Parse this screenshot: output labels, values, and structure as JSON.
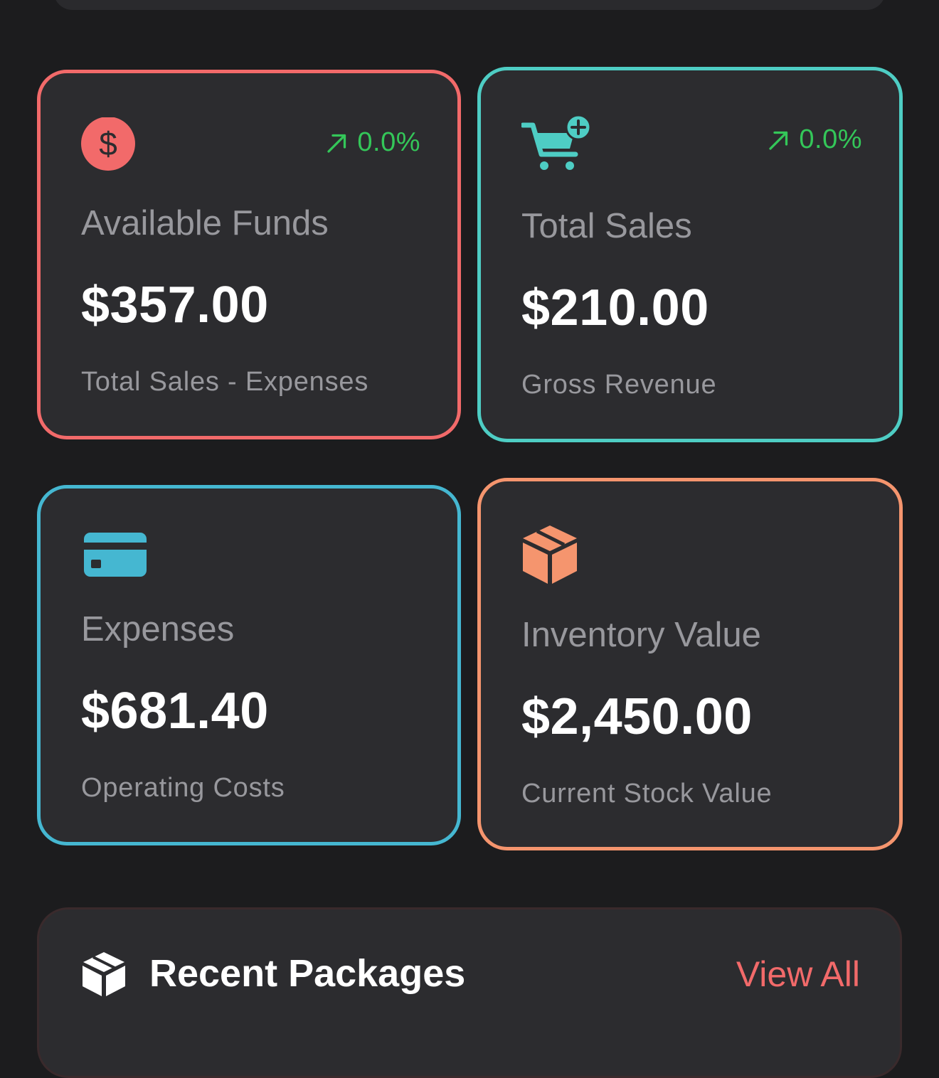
{
  "colors": {
    "background": "#1c1c1e",
    "card_background": "#2c2c2f",
    "funds_accent": "#f26a6a",
    "sales_accent": "#4ecdc4",
    "expenses_accent": "#45b7d1",
    "inventory_accent": "#f5956e",
    "trend_positive": "#34c759",
    "muted_text": "#98989d"
  },
  "cards": {
    "funds": {
      "icon": "dollar-circle-icon",
      "trend": "0.0%",
      "title": "Available Funds",
      "amount": "$357.00",
      "subtitle": "Total Sales - Expenses"
    },
    "sales": {
      "icon": "cart-plus-icon",
      "trend": "0.0%",
      "title": "Total Sales",
      "amount": "$210.00",
      "subtitle": "Gross Revenue"
    },
    "expenses": {
      "icon": "credit-card-icon",
      "title": "Expenses",
      "amount": "$681.40",
      "subtitle": "Operating Costs"
    },
    "inventory": {
      "icon": "box-icon",
      "title": "Inventory Value",
      "amount": "$2,450.00",
      "subtitle": "Current Stock Value"
    }
  },
  "recent_packages": {
    "icon": "package-icon",
    "title": "Recent Packages",
    "view_all_label": "View All"
  }
}
